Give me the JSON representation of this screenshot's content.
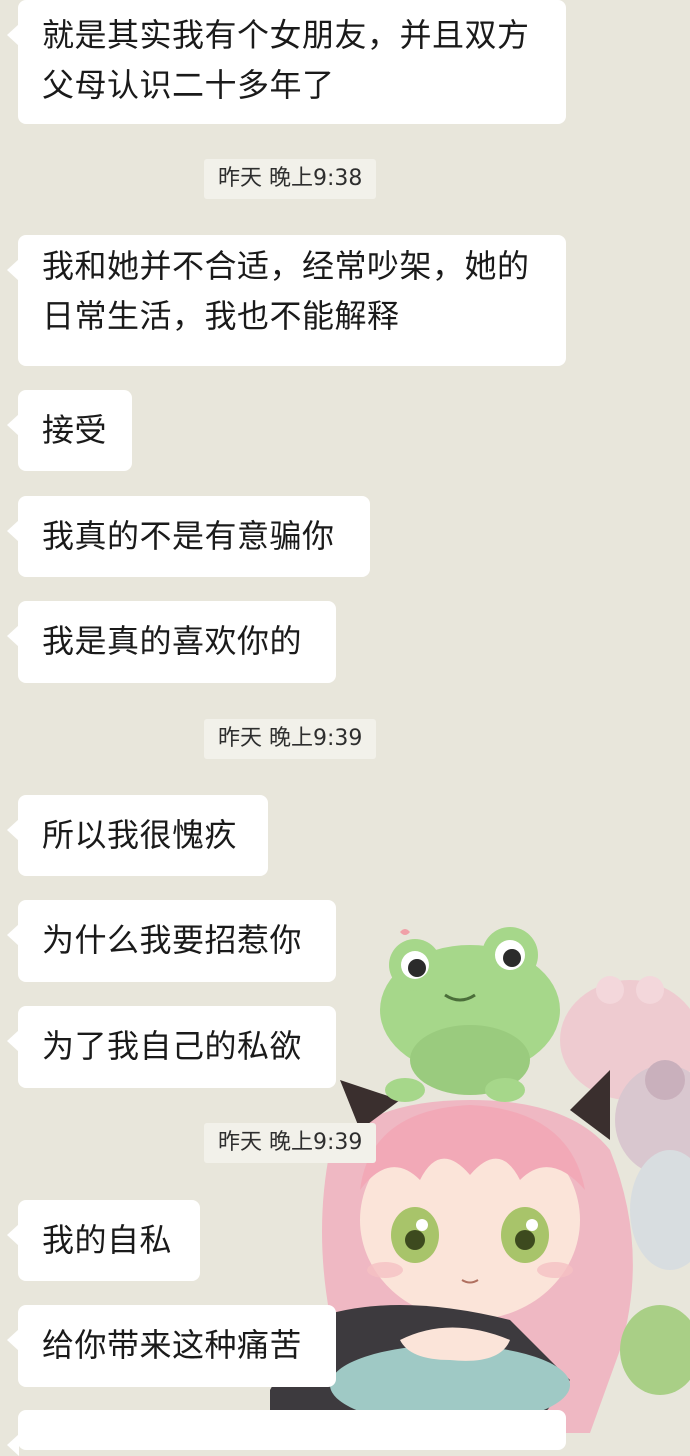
{
  "messages": [
    {
      "text": "就是其实我有个女朋友，并且双方\n父母认识二十多年了"
    },
    {
      "text": "我和她并不合适，经常吵架，她的\n日常生活，我也不能解释"
    },
    {
      "text": "接受"
    },
    {
      "text": "我真的不是有意骗你"
    },
    {
      "text": "我是真的喜欢你的"
    },
    {
      "text": "所以我很愧疚"
    },
    {
      "text": "为什么我要招惹你"
    },
    {
      "text": "为了我自己的私欲"
    },
    {
      "text": "我的自私"
    },
    {
      "text": "给你带来这种痛苦"
    },
    {
      "text": ""
    }
  ],
  "timestamps": [
    {
      "text": "昨天 晚上9:38"
    },
    {
      "text": "昨天 晚上9:39"
    },
    {
      "text": "昨天 晚上9:39"
    }
  ],
  "sticker": {
    "icon": "anime-girl-with-frogs-sticker"
  },
  "colors": {
    "background": "#e8e6db",
    "bubble": "#ffffff",
    "timestamp_bg": "#f2f1ea"
  }
}
